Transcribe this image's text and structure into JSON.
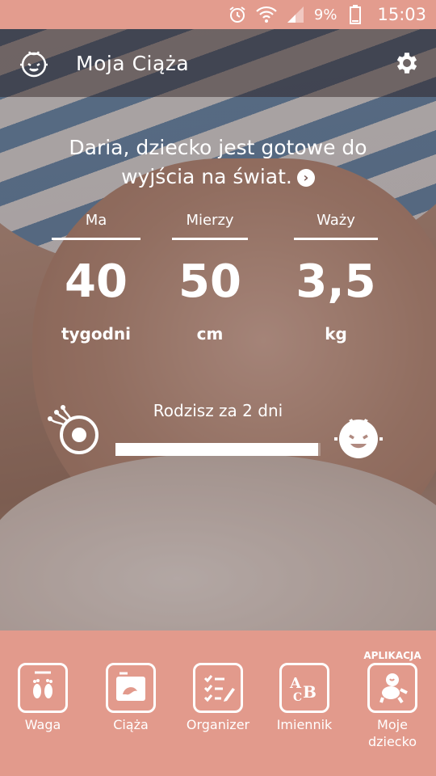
{
  "status_bar": {
    "battery": "9%",
    "time": "15:03"
  },
  "app_bar": {
    "title": "Moja Ciąża"
  },
  "headline": {
    "text": "Daria, dziecko jest gotowe do wyjścia na świat."
  },
  "stats": [
    {
      "label": "Ma",
      "value": "40",
      "unit": "tygodni"
    },
    {
      "label": "Mierzy",
      "value": "50",
      "unit": "cm"
    },
    {
      "label": "Waży",
      "value": "3,5",
      "unit": "kg"
    }
  ],
  "progress": {
    "label": "Rodzisz za 2 dni",
    "fraction": 0.99
  },
  "bottom_nav": {
    "badge": "APLIKACJA",
    "items": [
      {
        "label": "Waga",
        "icon": "feet-icon"
      },
      {
        "label": "Ciąża",
        "icon": "ultrasound-icon"
      },
      {
        "label": "Organizer",
        "icon": "checklist-icon"
      },
      {
        "label": "Imiennik",
        "icon": "abc-icon"
      },
      {
        "label": "Moje dziecko",
        "icon": "crawling-baby-icon"
      }
    ]
  },
  "colors": {
    "accent": "#e29a8c",
    "text": "#ffffff"
  }
}
